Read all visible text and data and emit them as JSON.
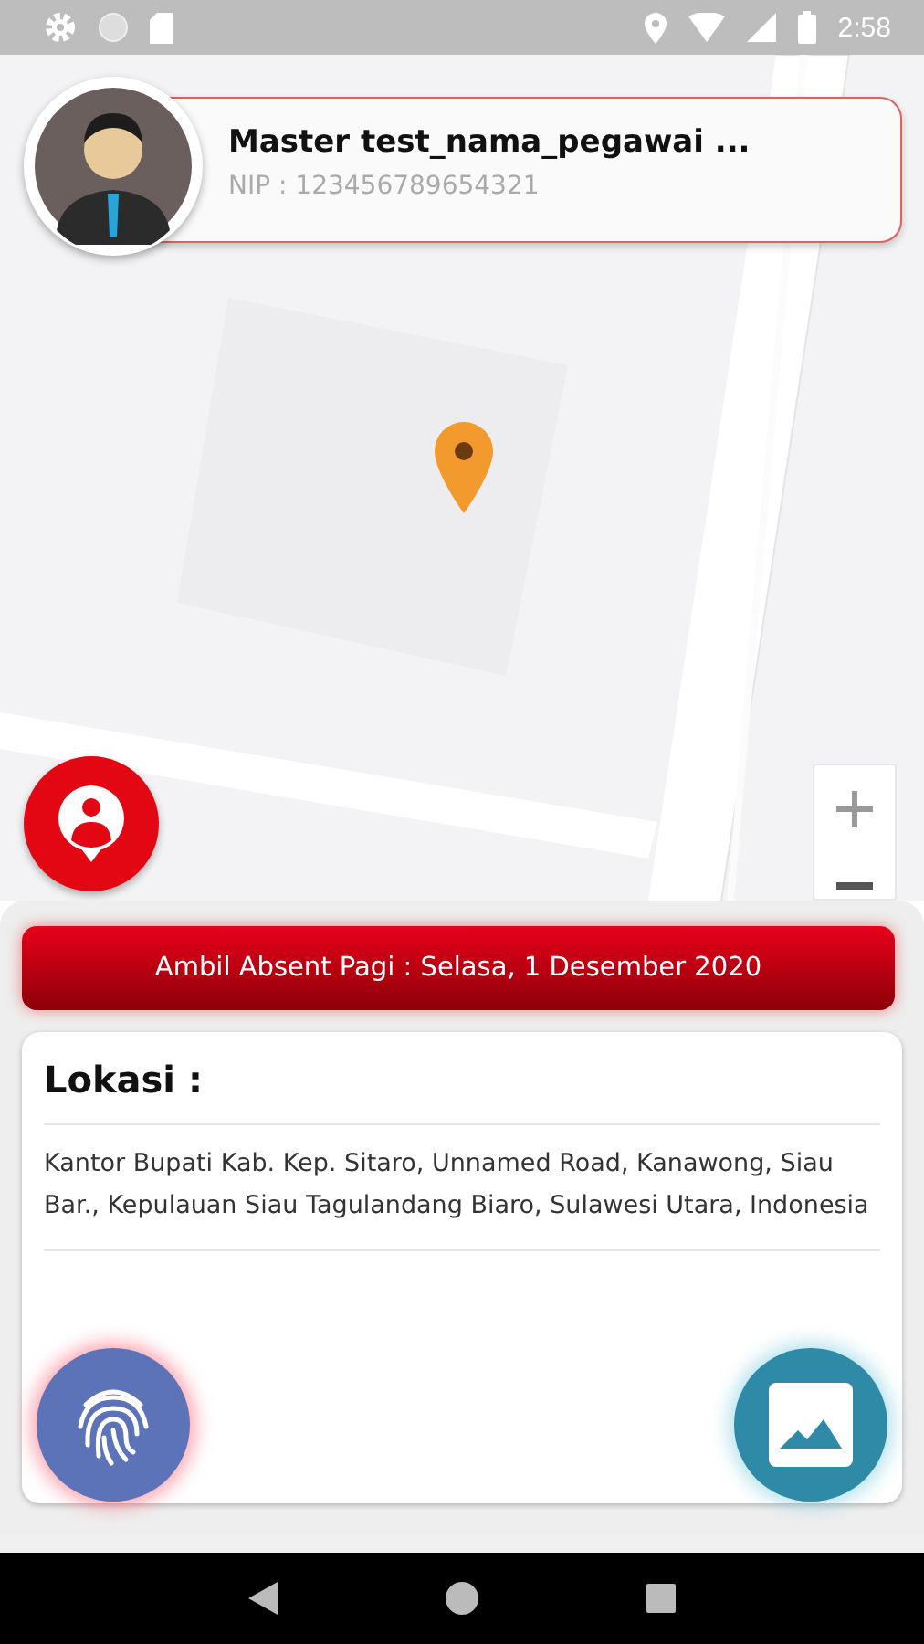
{
  "status_bar": {
    "time": "2:58"
  },
  "profile": {
    "name": "Master test_nama_pegawai ...",
    "nip": "NIP : 123456789654321"
  },
  "attendance_button": {
    "label": "Ambil Absent Pagi : Selasa, 1 Desember 2020"
  },
  "location": {
    "title": "Lokasi :",
    "address": "Kantor Bupati Kab. Kep. Sitaro, Unnamed Road, Kanawong, Siau Bar., Kepulauan Siau Tagulandang Biaro, Sulawesi Utara, Indonesia"
  }
}
